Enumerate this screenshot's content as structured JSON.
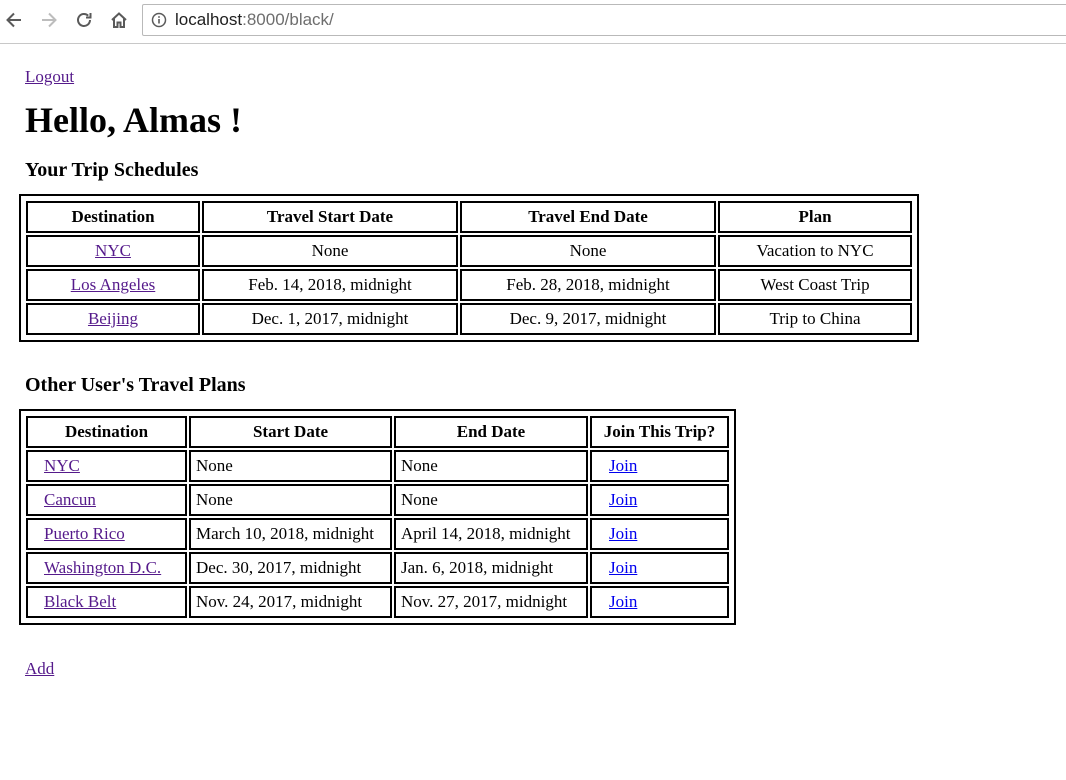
{
  "browser": {
    "url_host": "localhost",
    "url_rest": ":8000/black/"
  },
  "page": {
    "logout_label": "Logout",
    "greeting": "Hello, Almas !",
    "trips_heading": "Your Trip Schedules",
    "others_heading": "Other User's Travel Plans",
    "add_label": "Add"
  },
  "trips": {
    "headers": [
      "Destination",
      "Travel Start Date",
      "Travel End Date",
      "Plan"
    ],
    "rows": [
      {
        "destination": "NYC",
        "start": "None",
        "end": "None",
        "plan": "Vacation to NYC"
      },
      {
        "destination": "Los Angeles",
        "start": "Feb. 14, 2018, midnight",
        "end": "Feb. 28, 2018, midnight",
        "plan": "West Coast Trip"
      },
      {
        "destination": "Beijing",
        "start": "Dec. 1, 2017, midnight",
        "end": "Dec. 9, 2017, midnight",
        "plan": "Trip to China"
      }
    ]
  },
  "others": {
    "headers": [
      "Destination",
      "Start Date",
      "End Date",
      "Join This Trip?"
    ],
    "rows": [
      {
        "destination": "NYC",
        "start": "None",
        "end": "None",
        "join": "Join"
      },
      {
        "destination": "Cancun",
        "start": "None",
        "end": "None",
        "join": "Join"
      },
      {
        "destination": "Puerto Rico",
        "start": "March 10, 2018, midnight",
        "end": "April 14, 2018, midnight",
        "join": "Join"
      },
      {
        "destination": "Washington D.C.",
        "start": "Dec. 30, 2017, midnight",
        "end": "Jan. 6, 2018, midnight",
        "join": "Join"
      },
      {
        "destination": "Black Belt",
        "start": "Nov. 24, 2017, midnight",
        "end": "Nov. 27, 2017, midnight",
        "join": "Join"
      }
    ]
  },
  "icons": {
    "back": "back-arrow-icon",
    "forward": "forward-arrow-icon",
    "reload": "reload-icon",
    "home": "home-icon",
    "info": "info-icon"
  }
}
